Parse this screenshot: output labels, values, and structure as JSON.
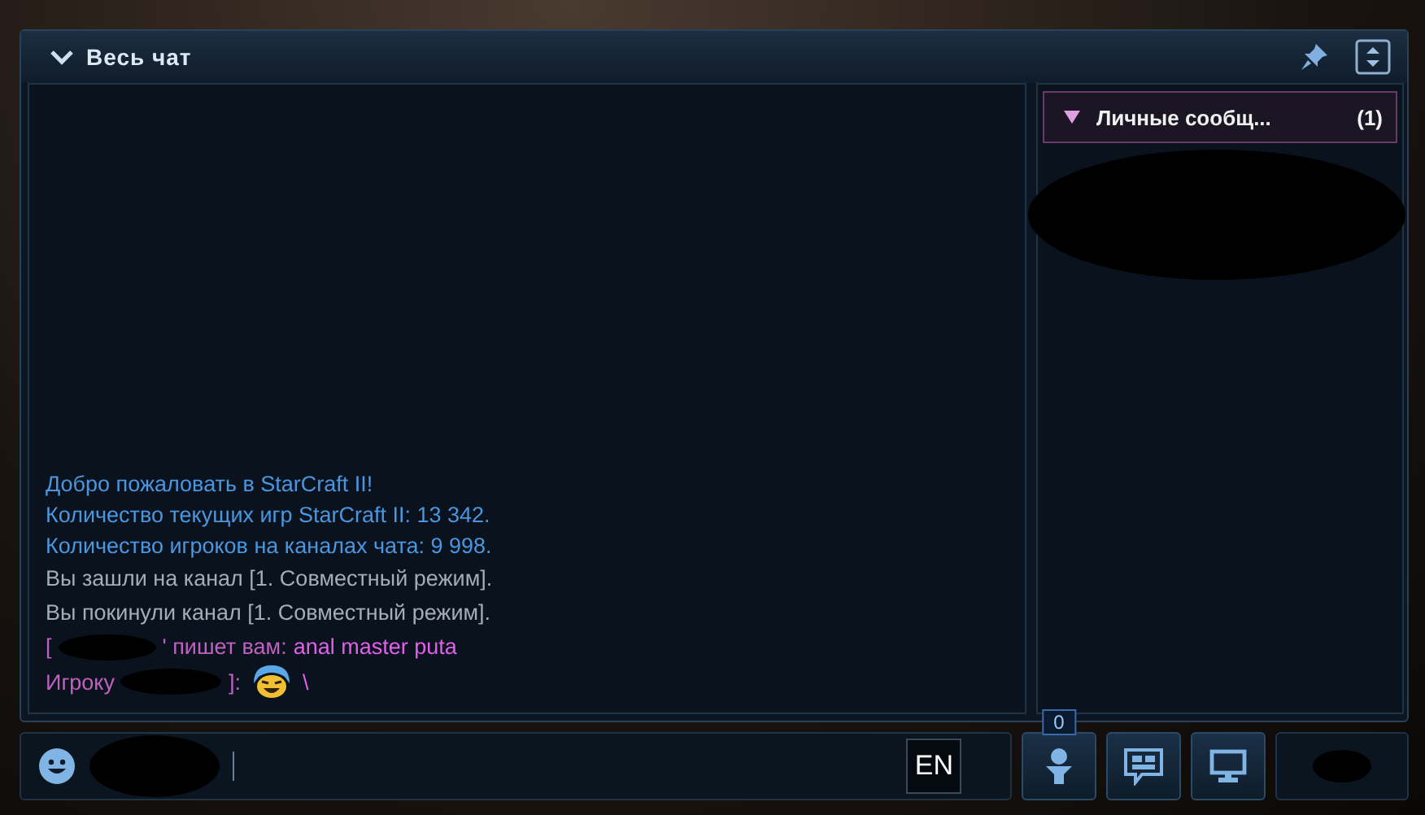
{
  "window": {
    "title": "Весь чат",
    "expanded": true
  },
  "messages": [
    {
      "kind": "system",
      "text": "Добро пожаловать в StarCraft II!"
    },
    {
      "kind": "system",
      "text": "Количество текущих игр StarCraft II: 13 342."
    },
    {
      "kind": "system",
      "text": "Количество игроков на каналах чата: 9 998."
    },
    {
      "kind": "notice",
      "text": "Вы зашли на канал [1. Совместный режим]."
    },
    {
      "kind": "notice",
      "text": "Вы покинули канал [1. Совместный режим]."
    },
    {
      "kind": "whisper_in",
      "before": "[",
      "after": "' пишет вам:",
      "body": "anal master puta"
    },
    {
      "kind": "whisper_out",
      "before": "Игроку",
      "after": "]:",
      "body": "\\"
    }
  ],
  "side_panel": {
    "title": "Личные сообщ...",
    "count": "(1)",
    "expanded": true
  },
  "input": {
    "language": "EN"
  },
  "friends_badge": "0"
}
